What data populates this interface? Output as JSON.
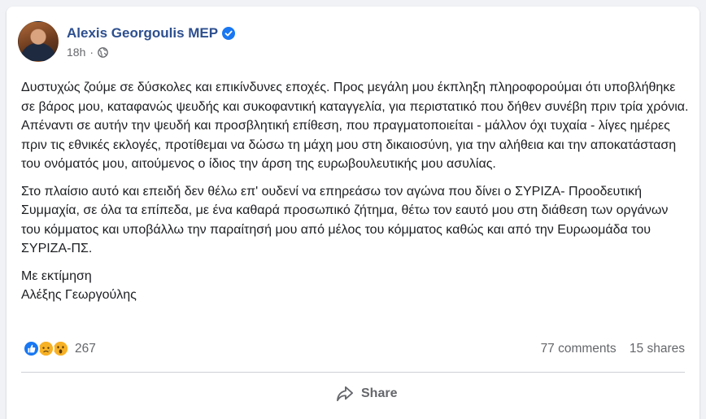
{
  "post": {
    "author": "Alexis Georgoulis MEP",
    "time": "18h",
    "separator": "·",
    "paragraphs": [
      "Δυστυχώς ζούμε σε δύσκολες και επικίνδυνες εποχές. Προς μεγάλη μου έκπληξη πληροφορούμαι ότι υποβλήθηκε σε βάρος μου, καταφανώς ψευδής και συκοφαντική καταγγελία, για περιστατικό που δήθεν συνέβη πριν τρία χρόνια. Απέναντι σε αυτήν την ψευδή και προσβλητική επίθεση, που πραγματοποιείται - μάλλον όχι τυχαία - λίγες ημέρες πριν τις εθνικές εκλογές, προτίθεμαι να δώσω τη μάχη μου στη δικαιοσύνη, για την αλήθεια και την αποκατάσταση του ονόματός μου, αιτούμενος ο ίδιος την άρση της ευρωβουλευτικής μου ασυλίας.",
      "Στο πλαίσιο αυτό και επειδή δεν θέλω επ' ουδενί να επηρεάσω τον αγώνα που δίνει ο ΣΥΡΙΖΑ- Προοδευτική Συμμαχία, σε όλα τα επίπεδα, με ένα καθαρά προσωπικό ζήτημα, θέτω τον εαυτό μου στη διάθεση των οργάνων του κόμματος και υποβάλλω την παραίτησή μου από μέλος του κόμματος καθώς και από την Ευρωομάδα του ΣΥΡΙΖΑ-ΠΣ."
    ],
    "closing": "Με εκτίμηση",
    "signature": "Αλέξης Γεωργούλης"
  },
  "stats": {
    "reaction_count": "267",
    "comments": "77 comments",
    "shares": "15 shares",
    "reactions": [
      "like",
      "sad",
      "wow"
    ]
  },
  "actions": {
    "share_label": "Share"
  },
  "colors": {
    "author": "#2d4f8f",
    "verified": "#1877f2",
    "muted": "#65676b"
  }
}
